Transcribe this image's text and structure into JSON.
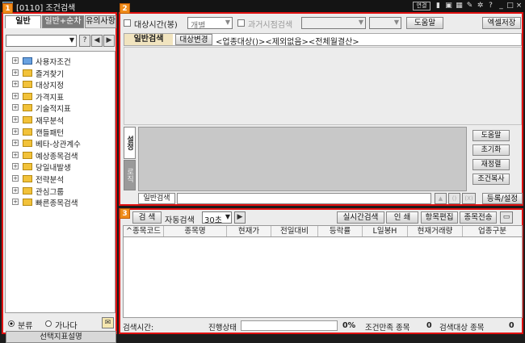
{
  "window": {
    "title": "[0110] 조건검색",
    "link_badge": "연결"
  },
  "pane_badges": [
    "1",
    "2",
    "3"
  ],
  "left_panel": {
    "tabs": [
      "일반",
      "일반+순차",
      "유의사항"
    ],
    "tree": [
      {
        "label": "사용자조건",
        "color": "blue"
      },
      {
        "label": "즐겨찾기",
        "color": "yellow"
      },
      {
        "label": "대상지정",
        "color": "yellow"
      },
      {
        "label": "가격지표",
        "color": "yellow"
      },
      {
        "label": "기술적지표",
        "color": "yellow"
      },
      {
        "label": "재무분석",
        "color": "yellow"
      },
      {
        "label": "캔들패턴",
        "color": "yellow"
      },
      {
        "label": "베타-상관계수",
        "color": "yellow"
      },
      {
        "label": "예상종목검색",
        "color": "yellow"
      },
      {
        "label": "당일내발생",
        "color": "yellow"
      },
      {
        "label": "전략분석",
        "color": "yellow"
      },
      {
        "label": "관심그룹",
        "color": "yellow"
      },
      {
        "label": "빠른종목검색",
        "color": "yellow"
      }
    ],
    "radio": {
      "opt1": "분류",
      "opt2": "가나다"
    },
    "desc_button": "선택지표설명"
  },
  "condition_panel": {
    "target_time_label": "대상시간(봉)",
    "target_time_value": "개별",
    "past_search_label": "과거시점검색",
    "help_button": "도움말",
    "excel_button": "엑셀저장",
    "general_search_label": "일반검색",
    "change_target_button": "대상변경",
    "condition_text": "<업종대상()><제외없음><전체월결산>",
    "side_tabs": [
      "설정",
      "로직"
    ],
    "right_buttons": [
      "도움말",
      "초기화",
      "재정렬",
      "조건복사"
    ],
    "bottom_tab": "일반검색",
    "paren_buttons": [
      "▲",
      "()",
      "(X)"
    ],
    "register_button": "등록/설정"
  },
  "results_panel": {
    "search_button": "검  색",
    "auto_search_label": "자동검색",
    "interval_value": "30초",
    "play_icon": "▶",
    "buttons": [
      "실시간검색",
      "인  쇄",
      "항목편집",
      "종목전송"
    ],
    "columns": [
      "^종목코드",
      "종목명",
      "현재가",
      "전일대비",
      "등락률",
      "L일봉H",
      "현재거래량",
      "업종구분"
    ],
    "status": {
      "search_time_label": "검색시간:",
      "progress_label": "진행상태",
      "progress_text": "0%",
      "progress_value": 0,
      "match_label": "조건만족 종목",
      "match_count": "0",
      "target_label": "검색대상 종목",
      "target_count": "0"
    }
  }
}
